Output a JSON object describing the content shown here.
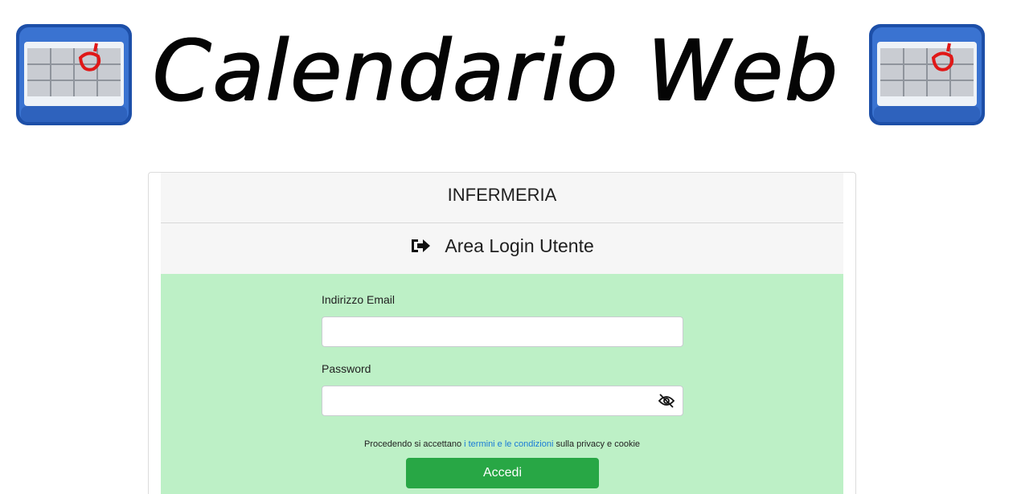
{
  "banner": {
    "title": "Calendario Web",
    "logo_icon": "calendar-icon"
  },
  "card": {
    "org_name": "INFERMERIA",
    "login_title": "Area Login Utente",
    "login_icon": "sign-in-icon"
  },
  "form": {
    "email_label": "Indirizzo Email",
    "email_value": "",
    "password_label": "Password",
    "password_value": "",
    "password_toggle_icon": "eye-slash-icon",
    "terms_prefix": "Procedendo si accettano ",
    "terms_link": "i termini e le condizioni",
    "terms_suffix": " sulla privacy e cookie",
    "submit_label": "Accedi"
  },
  "colors": {
    "form_background": "#bdf0c6",
    "header_background": "#f6f6f6",
    "submit_button": "#28a745",
    "link": "#1a7bd6"
  }
}
